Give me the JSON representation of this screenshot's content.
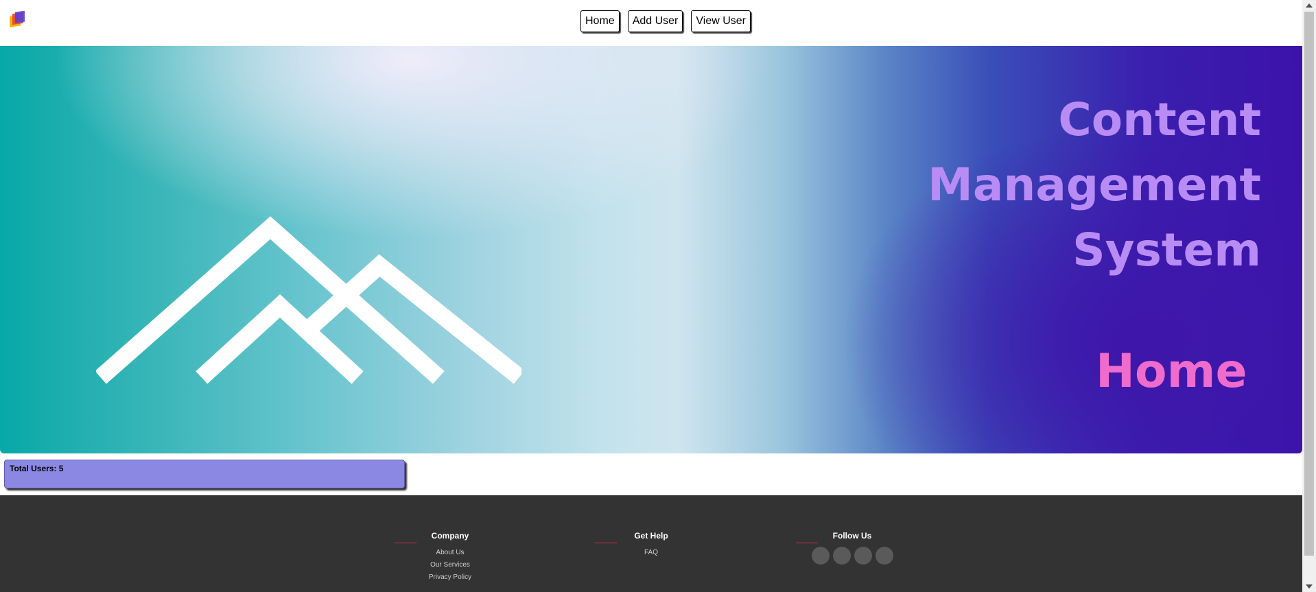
{
  "nav": {
    "home_label": "Home",
    "add_user_label": "Add User",
    "view_user_label": "View User"
  },
  "hero": {
    "title_lines": [
      "Content",
      "Management",
      "System"
    ],
    "page_label": "Home"
  },
  "stats": {
    "total_users_text": "Total Users: 5"
  },
  "footer": {
    "company": {
      "heading": "Company",
      "links": [
        "About Us",
        "Our Services",
        "Privacy Policy"
      ]
    },
    "help": {
      "heading": "Get Help",
      "links": [
        "FAQ"
      ]
    },
    "follow": {
      "heading": "Follow Us",
      "icons": [
        "social-icon-1",
        "social-icon-2",
        "social-icon-3",
        "social-icon-4"
      ]
    }
  },
  "colors": {
    "title": "#b98cf5",
    "home_label": "#ef6bcc",
    "stats_bg": "#8b88e3",
    "footer_bg": "#333333",
    "footer_accent": "#e0284c"
  }
}
